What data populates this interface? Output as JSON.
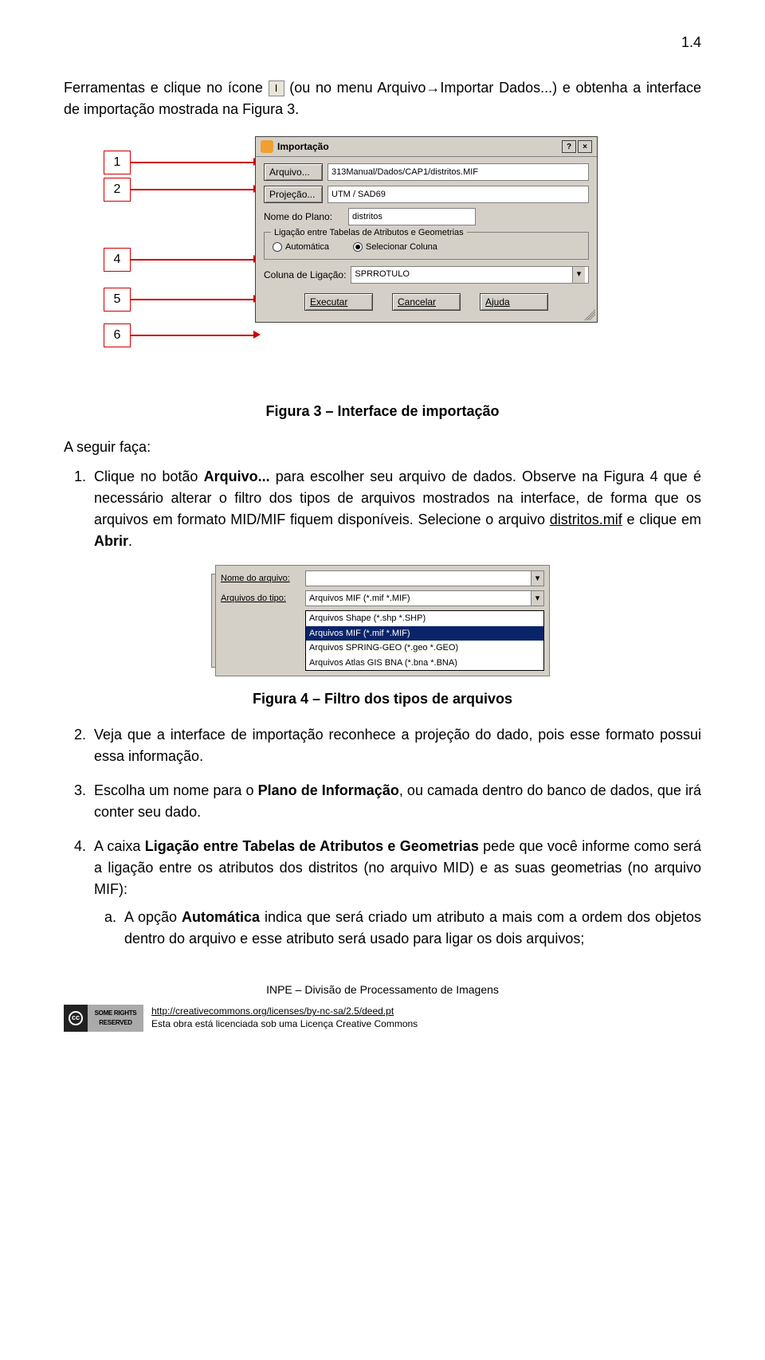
{
  "pageNumber": "1.4",
  "intro": {
    "p1a": "Ferramentas e clique no ícone ",
    "iconGlyph": "I",
    "p1b": " (ou no menu Arquivo→Importar Dados...) e obtenha a interface de importação mostrada na Figura 3."
  },
  "callouts": [
    "1",
    "2",
    "4",
    "5",
    "6"
  ],
  "dialog": {
    "title": "Importação",
    "helpBtn": "?",
    "closeBtn": "×",
    "arquivoBtn": "Arquivo...",
    "arquivoValue": "313Manual/Dados/CAP1/distritos.MIF",
    "projecaoBtn": "Projeção...",
    "projecaoValue": "UTM / SAD69",
    "nomePlanoLabel": "Nome do Plano:",
    "nomePlanoValue": "distritos",
    "fieldsetLegend": "Ligação entre Tabelas de Atributos e Geometrias",
    "radioAuto": "Automática",
    "radioSelecionar": "Selecionar Coluna",
    "colunaLabel": "Coluna de Ligação:",
    "colunaValue": "SPRROTULO",
    "executarBtn": "Executar",
    "cancelarBtn": "Cancelar",
    "ajudaBtn": "Ajuda"
  },
  "caption3": "Figura 3 – Interface de importação",
  "followText": "A seguir faça:",
  "step1": {
    "num": "1.",
    "p_a": "Clique no botão ",
    "strong": "Arquivo...",
    "p_b": " para escolher seu arquivo de dados. Observe na Figura 4 que é necessário alterar o filtro dos tipos de arquivos mostrados na interface, de forma que os arquivos em formato MID/MIF fiquem disponíveis. Selecione o arquivo ",
    "underline": "distritos.mif",
    "p_c": " e clique em ",
    "strong2": "Abrir",
    "p_d": "."
  },
  "filterFig": {
    "nomeLabel": "Nome do arquivo:",
    "tipoLabel": "Arquivos do tipo:",
    "tipoValue": "Arquivos MIF  (*.mif *.MIF)",
    "options": [
      {
        "label": "Arquivos Shape (*.shp *.SHP)",
        "selected": false
      },
      {
        "label": "Arquivos MIF  (*.mif *.MIF)",
        "selected": true
      },
      {
        "label": "Arquivos SPRING-GEO (*.geo *.GEO)",
        "selected": false
      },
      {
        "label": "Arquivos Atlas GIS BNA (*.bna *.BNA)",
        "selected": false
      }
    ]
  },
  "caption4": "Figura 4 – Filtro dos tipos de arquivos",
  "step2": {
    "num": "2.",
    "text": "Veja que a interface de importação reconhece a projeção do dado, pois esse formato possui essa informação."
  },
  "step3": {
    "num": "3.",
    "a": "Escolha um nome para o ",
    "strong": "Plano de Informação",
    "b": ", ou camada dentro do banco de dados, que irá conter seu dado."
  },
  "step4": {
    "num": "4.",
    "a": "A caixa ",
    "strong": "Ligação entre Tabelas de Atributos e Geometrias",
    "b": " pede que você informe como será a ligação entre os atributos dos distritos (no arquivo MID) e as suas geometrias (no arquivo MIF):"
  },
  "step4a": {
    "num": "a.",
    "a": "A opção ",
    "strong": "Automática",
    "b": " indica que será criado um atributo a mais com a ordem dos objetos dentro do arquivo e esse atributo será usado para ligar os dois arquivos;"
  },
  "footer": {
    "inpe": "INPE – Divisão de Processamento de Imagens",
    "ccGlyph": "cc",
    "ccRight": "SOME RIGHTS RESERVED",
    "link": "http://creativecommons.org/licenses/by-nc-sa/2.5/deed.pt",
    "text": "Esta obra está licenciada sob uma Licença Creative Commons"
  }
}
